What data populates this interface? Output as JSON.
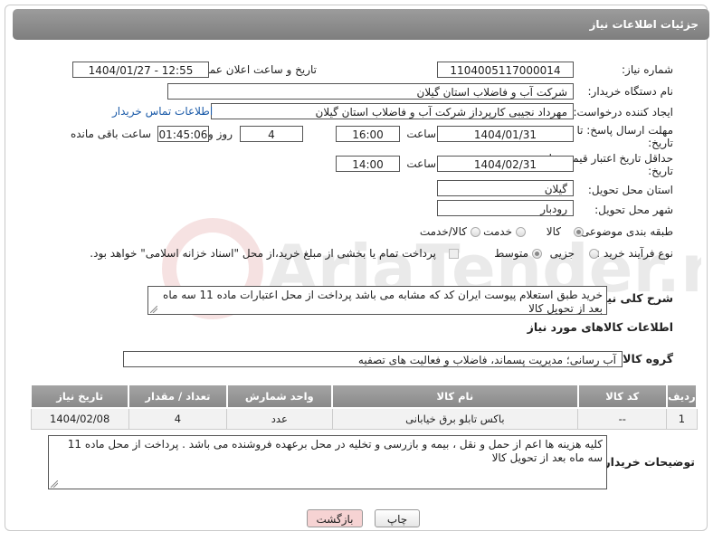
{
  "header": {
    "title": "جزئیات اطلاعات نیاز"
  },
  "fields": {
    "need_number": {
      "label": "شماره نیاز:",
      "value": "1104005117000014"
    },
    "announce": {
      "label": "تاریخ و ساعت اعلان عمومی:",
      "value": "1404/01/27 - 12:55"
    },
    "buyer": {
      "label": "نام دستگاه خریدار:",
      "value": "شرکت آب و فاضلاب استان گیلان"
    },
    "creator": {
      "label": "ایجاد کننده درخواست:",
      "value": "مهرداد نجیبی کارپرداز شرکت آب و فاضلاب استان گیلان",
      "link": "اطلاعات تماس خریدار"
    },
    "deadline": {
      "label": "مهلت ارسال پاسخ: تا تاریخ:",
      "date": "1404/01/31",
      "time_label": "ساعت",
      "time": "16:00",
      "days": "4",
      "days_label": "روز و",
      "remaining": "01:45:06",
      "remaining_label": "ساعت باقی مانده"
    },
    "validity": {
      "label": "حداقل تاریخ اعتبار قیمت: تا تاریخ:",
      "date": "1404/02/31",
      "time_label": "ساعت",
      "time": "14:00"
    },
    "province": {
      "label": "استان محل تحویل:",
      "value": "گیلان"
    },
    "city": {
      "label": "شهر محل تحویل:",
      "value": "رودبار"
    },
    "category": {
      "label": "طبقه بندی موضوعی:",
      "options": [
        "کالا",
        "خدمت",
        "کالا/خدمت"
      ],
      "selected": "کالا"
    },
    "process": {
      "label": "نوع فرآیند خرید :",
      "options": [
        "جزیی",
        "متوسط"
      ],
      "selected": "متوسط",
      "payment_note": "پرداخت تمام یا بخشی از مبلغ خرید،از محل \"اسناد خزانه اسلامی\" خواهد بود."
    }
  },
  "description": {
    "label": "شرح کلی نیاز:",
    "text": "خرید طبق استعلام پیوست ایران کد که مشابه می باشد پرداخت از محل اعتبارات ماده 11 سه ماه بعد از تحویل کالا"
  },
  "goods_section": {
    "title": "اطلاعات کالاهای مورد نیاز"
  },
  "goods_group": {
    "label": "گروه کالا:",
    "value": "آب رسانی؛ مدیریت پسماند، فاضلاب و فعالیت های تصفیه"
  },
  "table": {
    "headers": [
      "ردیف",
      "کد کالا",
      "نام کالا",
      "واحد شمارش",
      "تعداد / مقدار",
      "تاریخ نیاز"
    ],
    "rows": [
      [
        "1",
        "--",
        "باکس تابلو برق خیابانی",
        "عدد",
        "4",
        "1404/02/08"
      ]
    ]
  },
  "buyer_notes": {
    "label": "توضیحات خریدار:",
    "text": "کلیه هزینه ها اعم از حمل و نقل ، بیمه و بازرسی و تخلیه در محل برعهده فروشنده می باشد . پرداخت از محل ماده 11 سه ماه بعد از تحویل کالا"
  },
  "buttons": {
    "print": "چاپ",
    "back": "بازگشت"
  },
  "watermark": {
    "text": "AriaTender.neT"
  },
  "colors": {
    "header": "#8a8a8a",
    "link": "#1a5aa8",
    "back_button": "#f6d3d3"
  }
}
